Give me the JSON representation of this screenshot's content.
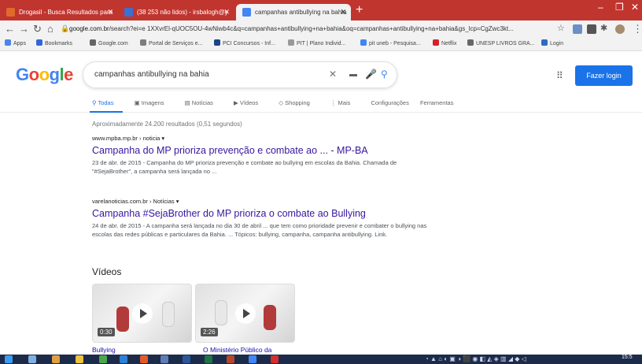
{
  "browser": {
    "tabs": [
      {
        "title": "Drogasil - Busca Resultados para",
        "color": "#e06a2c"
      },
      {
        "title": "(38 253 não lidos) - irsbalogh@y",
        "color": "#3b6fd4"
      },
      {
        "title": "campanhas antibullying na bahia",
        "color": "#4285f4"
      }
    ],
    "new_tab": "+",
    "address": {
      "host": "google.com.br",
      "path": "/search?ei=e 1XXvrEl-qUOC5OU-4wNiwb4c&q=campanhas+antibullying+na+bahia&oq=campanhas+antibullying+na+bahia&gs_lcp=CgZwc3kt..."
    },
    "bookmarks": [
      {
        "label": "Apps",
        "color": "#4a86e8"
      },
      {
        "label": "Bookmarks",
        "color": "#3367d6"
      },
      {
        "label": "Google.com",
        "color": "#666666"
      },
      {
        "label": "Portal de Serviços e...",
        "color": "#7d7d7d"
      },
      {
        "label": "PCI Concursos - Inf...",
        "color": "#1c4587"
      },
      {
        "label": "PIT | Plano Individ...",
        "color": "#999999"
      },
      {
        "label": "pit uneb - Pesquisa...",
        "color": "#4285f4"
      },
      {
        "label": "Netflix",
        "color": "#d81f26"
      },
      {
        "label": "UNESP LIVROS GRA...",
        "color": "#666666"
      },
      {
        "label": "Login",
        "color": "#2a6cc4"
      }
    ]
  },
  "google": {
    "logo": [
      {
        "ch": "G",
        "color": "#4285f4"
      },
      {
        "ch": "o",
        "color": "#ea4335"
      },
      {
        "ch": "o",
        "color": "#fbbc05"
      },
      {
        "ch": "g",
        "color": "#4285f4"
      },
      {
        "ch": "l",
        "color": "#34a853"
      },
      {
        "ch": "e",
        "color": "#ea4335"
      }
    ],
    "query": "campanhas antibullying na bahia",
    "login_label": "Fazer login",
    "tabs": [
      "Todas",
      "Imagens",
      "Notícias",
      "Vídeos",
      "Shopping",
      "Mais",
      "Configurações",
      "Ferramentas"
    ],
    "stats": "Aproximadamente 24.200 resultados (0,51 segundos)",
    "results": [
      {
        "url": "www.mpba.mp.br › noticia ▾",
        "title": "Campanha do MP prioriza prevenção e combate ao ... - MP-BA",
        "snippet": "23 de abr. de 2015 - Campanha do MP prioriza prevenção e combate ao bullying em escolas da Bahia. Chamada de \"#SejaBrother\", a campanha será lançada no ..."
      },
      {
        "url": "varelanoticias.com.br › Notícias ▾",
        "title": "Campanha #SejaBrother do MP prioriza o combate ao Bullying",
        "snippet": "24 de abr. de 2015 - A campanha será lançada no dia 30 de abril ... que tem como prioridade prevenir e combater o bullying nas escolas das redes públicas e particulares da Bahia. ... Tópicos: bullying, campanha, campanha antibullying. Link."
      }
    ],
    "videos_heading": "Vídeos",
    "videos": [
      {
        "duration": "0:30",
        "title": "Bullying"
      },
      {
        "duration": "2:26",
        "title": "O Ministério Público da"
      }
    ]
  },
  "taskbar": {
    "clock": "15:5"
  }
}
